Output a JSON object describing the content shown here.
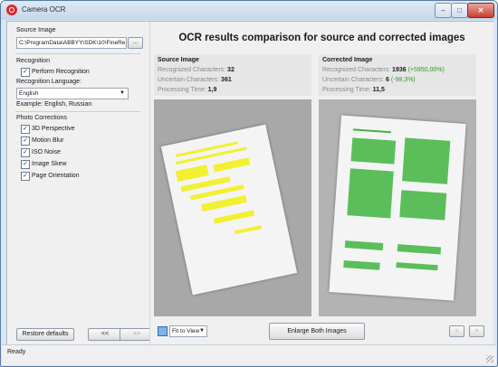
{
  "window": {
    "title": "Camera OCR",
    "minimize": "–",
    "maximize": "□",
    "close": "✕"
  },
  "left": {
    "source_image_label": "Source Image",
    "source_image_path": "C:\\ProgramData\\ABBYY\\SDK\\10\\FineRe",
    "browse_label": "...",
    "recognition_header": "Recognition",
    "perform_recognition_label": "Perform Recognition",
    "perform_recognition_checked": "✓",
    "language_label": "Recognition Language:",
    "language_value": "English",
    "language_example": "Example: English, Russian",
    "photo_corrections_header": "Photo Corrections",
    "corrections": [
      {
        "label": "3D Perspective",
        "check": "✓"
      },
      {
        "label": "Motion Blur",
        "check": "✓"
      },
      {
        "label": "ISO Noise",
        "check": "✓"
      },
      {
        "label": "Image Skew",
        "check": "✓"
      },
      {
        "label": "Page Orientation",
        "check": "✓"
      }
    ],
    "restore_defaults": "Restore defaults",
    "prev_label": "<<",
    "next_label": ">>"
  },
  "right": {
    "heading": "OCR results comparison for source and corrected images",
    "source": {
      "title": "Source Image",
      "recognized_label": "Recognized Characters:",
      "recognized_value": "32",
      "uncertain_label": "Uncertain Characters:",
      "uncertain_value": "361",
      "time_label": "Processing Time:",
      "time_value": "1,9"
    },
    "corrected": {
      "title": "Corrected Image",
      "recognized_label": "Recognized Characters:",
      "recognized_value": "1936",
      "recognized_delta": "(+5950,00%)",
      "uncertain_label": "Uncertain Characters:",
      "uncertain_value": "6",
      "uncertain_delta": "(-98,3%)",
      "time_label": "Processing Time:",
      "time_value": "11,5"
    },
    "fit_label": "Fit to View",
    "enlarge_label": "Enlarge Both Images",
    "nav_prev": "<",
    "nav_next": ">"
  },
  "status": {
    "text": "Ready"
  },
  "colors": {
    "highlight_yellow": "#f2f031",
    "recognized_green": "#3fb43f",
    "delta_green": "#2e9b2e"
  }
}
